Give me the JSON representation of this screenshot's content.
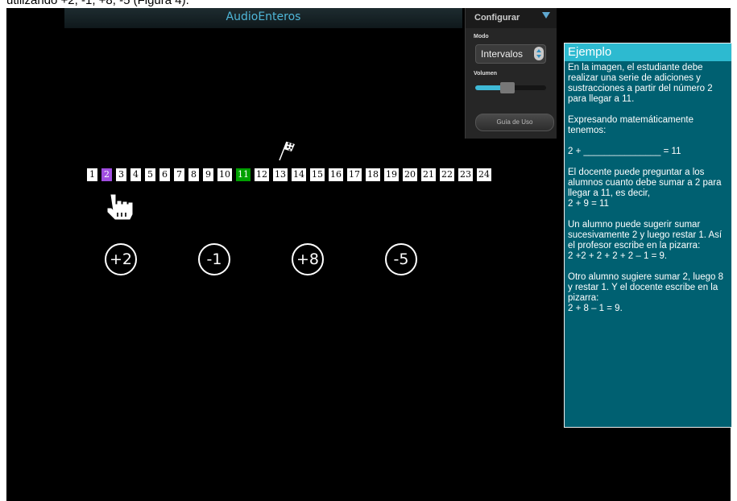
{
  "caption": "utilizando +2, -1, +8, -5 (Figura 4).",
  "app": {
    "title": "AudioEnteros"
  },
  "config": {
    "label": "Configurar",
    "modo_label": "Modo",
    "modo_value": "Intervalos",
    "volumen_label": "Volumen",
    "volume_level": 0.45,
    "guia_button": "Guía de Uso"
  },
  "number_line": {
    "numbers": [
      "1",
      "2",
      "3",
      "4",
      "5",
      "6",
      "7",
      "8",
      "9",
      "10",
      "11",
      "12",
      "13",
      "14",
      "15",
      "16",
      "17",
      "18",
      "19",
      "20",
      "21",
      "22",
      "23",
      "24"
    ],
    "start_value": "2",
    "target_value": "11",
    "start_color": "#a04de0",
    "target_color": "#00a000"
  },
  "operations": [
    "+2",
    "-1",
    "+8",
    "-5"
  ],
  "panel": {
    "title": "Ejemplo",
    "paragraphs": [
      [
        "En la imagen, el estudiante debe realizar una serie de adiciones y sustracciones a partir del número 2 para llegar a 11."
      ],
      [
        "Expresando matemáticamente tenemos:"
      ],
      [
        "2 + _______________ = 11"
      ],
      [
        "El docente puede preguntar a los alumnos cuanto debe sumar a 2 para llegar a 11, es decir,",
        "2 + 9 = 11"
      ],
      [
        "Un alumno puede sugerir sumar sucesivamente 2 y luego restar 1. Así el profesor escribe en la pizarra:",
        "2 +2 + 2 + 2 + 2 – 1 = 9."
      ],
      [
        "Otro alumno sugiere sumar 2, luego 8 y restar 1. Y el docente escribe en la pizarra:",
        "2 + 8 – 1 = 9."
      ]
    ]
  },
  "colors": {
    "accent": "#2dbad0",
    "panel_bg": "#006071",
    "title_text": "#4fb6d8"
  },
  "icons": [
    "checkered-flag-icon",
    "hand-pointer-icon",
    "chevron-down-icon",
    "spinner-up-icon",
    "spinner-down-icon"
  ]
}
